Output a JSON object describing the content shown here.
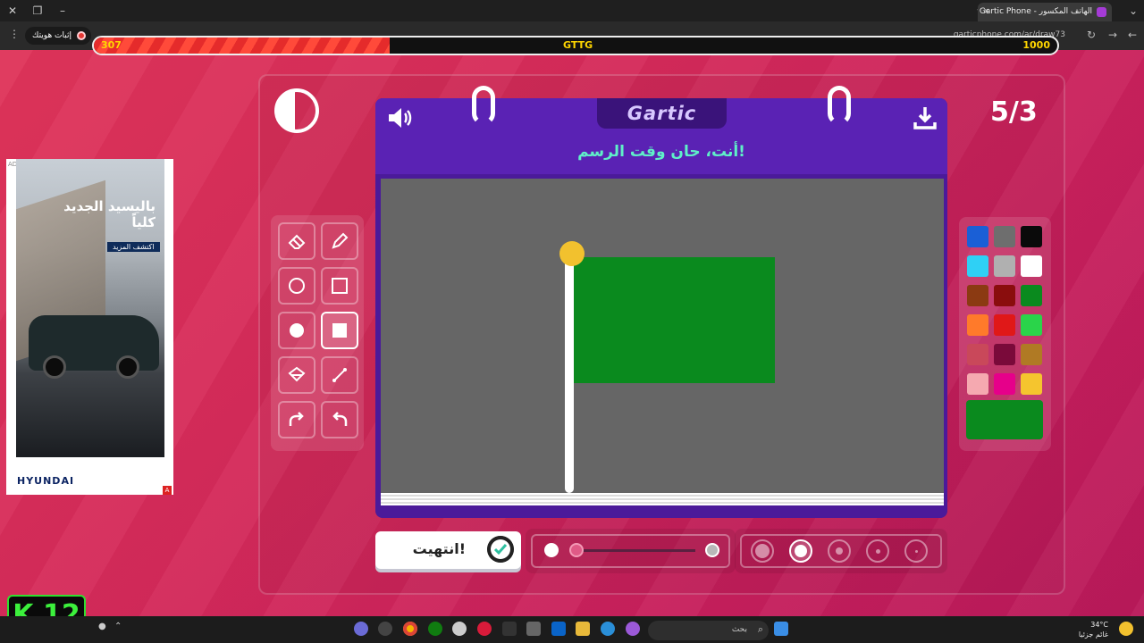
{
  "browser": {
    "tab_title": "Gartic Phone - الهاتف المكسور",
    "tab_close": "×",
    "new_tab": "+",
    "recording_label": "إثبات هويتك",
    "url": "garticphone.com/ar/draw73"
  },
  "healthbar": {
    "left_value": "307",
    "center_label": "GTTG",
    "right_value": "1000",
    "fill_fraction": 0.307,
    "fill_color": "#e52b2b"
  },
  "game": {
    "logo": "Gartic",
    "prompt": "أنت، حان وقت الرسم!",
    "round_counter": "5/3",
    "done_label": "انتهيت!",
    "canvas_color": "#666666",
    "flag_color": "#0a8a1e",
    "pole_ball_color": "#f2c12e",
    "icons": {
      "timer": "moon-timer-icon",
      "sound": "speaker-icon",
      "download": "download-icon",
      "done": "check-icon"
    }
  },
  "tools": [
    {
      "name": "eraser-icon"
    },
    {
      "name": "pencil-icon"
    },
    {
      "name": "circle-outline-icon"
    },
    {
      "name": "square-outline-icon"
    },
    {
      "name": "circle-fill-icon"
    },
    {
      "name": "square-fill-icon",
      "active": true
    },
    {
      "name": "fill-bucket-icon"
    },
    {
      "name": "line-icon"
    },
    {
      "name": "redo-icon"
    },
    {
      "name": "undo-icon"
    }
  ],
  "palette": {
    "colors": [
      "#1a5fd6",
      "#6e6e6e",
      "#0a0a0a",
      "#2fd0f5",
      "#b0b0b0",
      "#ffffff",
      "#8b3a12",
      "#8a0d0d",
      "#0a8a1e",
      "#ff7a2a",
      "#e01818",
      "#2ad44a",
      "#c9485a",
      "#7a0a3a",
      "#b07a24",
      "#f5a9b0",
      "#e6008a",
      "#f5c52e"
    ],
    "current": "#0a8a1e"
  },
  "brush": {
    "opacity_fraction": 0.0,
    "size_options": 5,
    "selected_size_index": 1
  },
  "ad": {
    "flag": "AD",
    "title": "باليسيد الجديد كلياً",
    "cta": "اكتشف المزيد",
    "brand": "HYUNDAI",
    "corner": "A"
  },
  "taskbar": {
    "search_placeholder": "بحث",
    "temperature": "34°C",
    "weather_text": "غائم جزئيا"
  },
  "overlay": {
    "channel_badge": "K 12"
  }
}
